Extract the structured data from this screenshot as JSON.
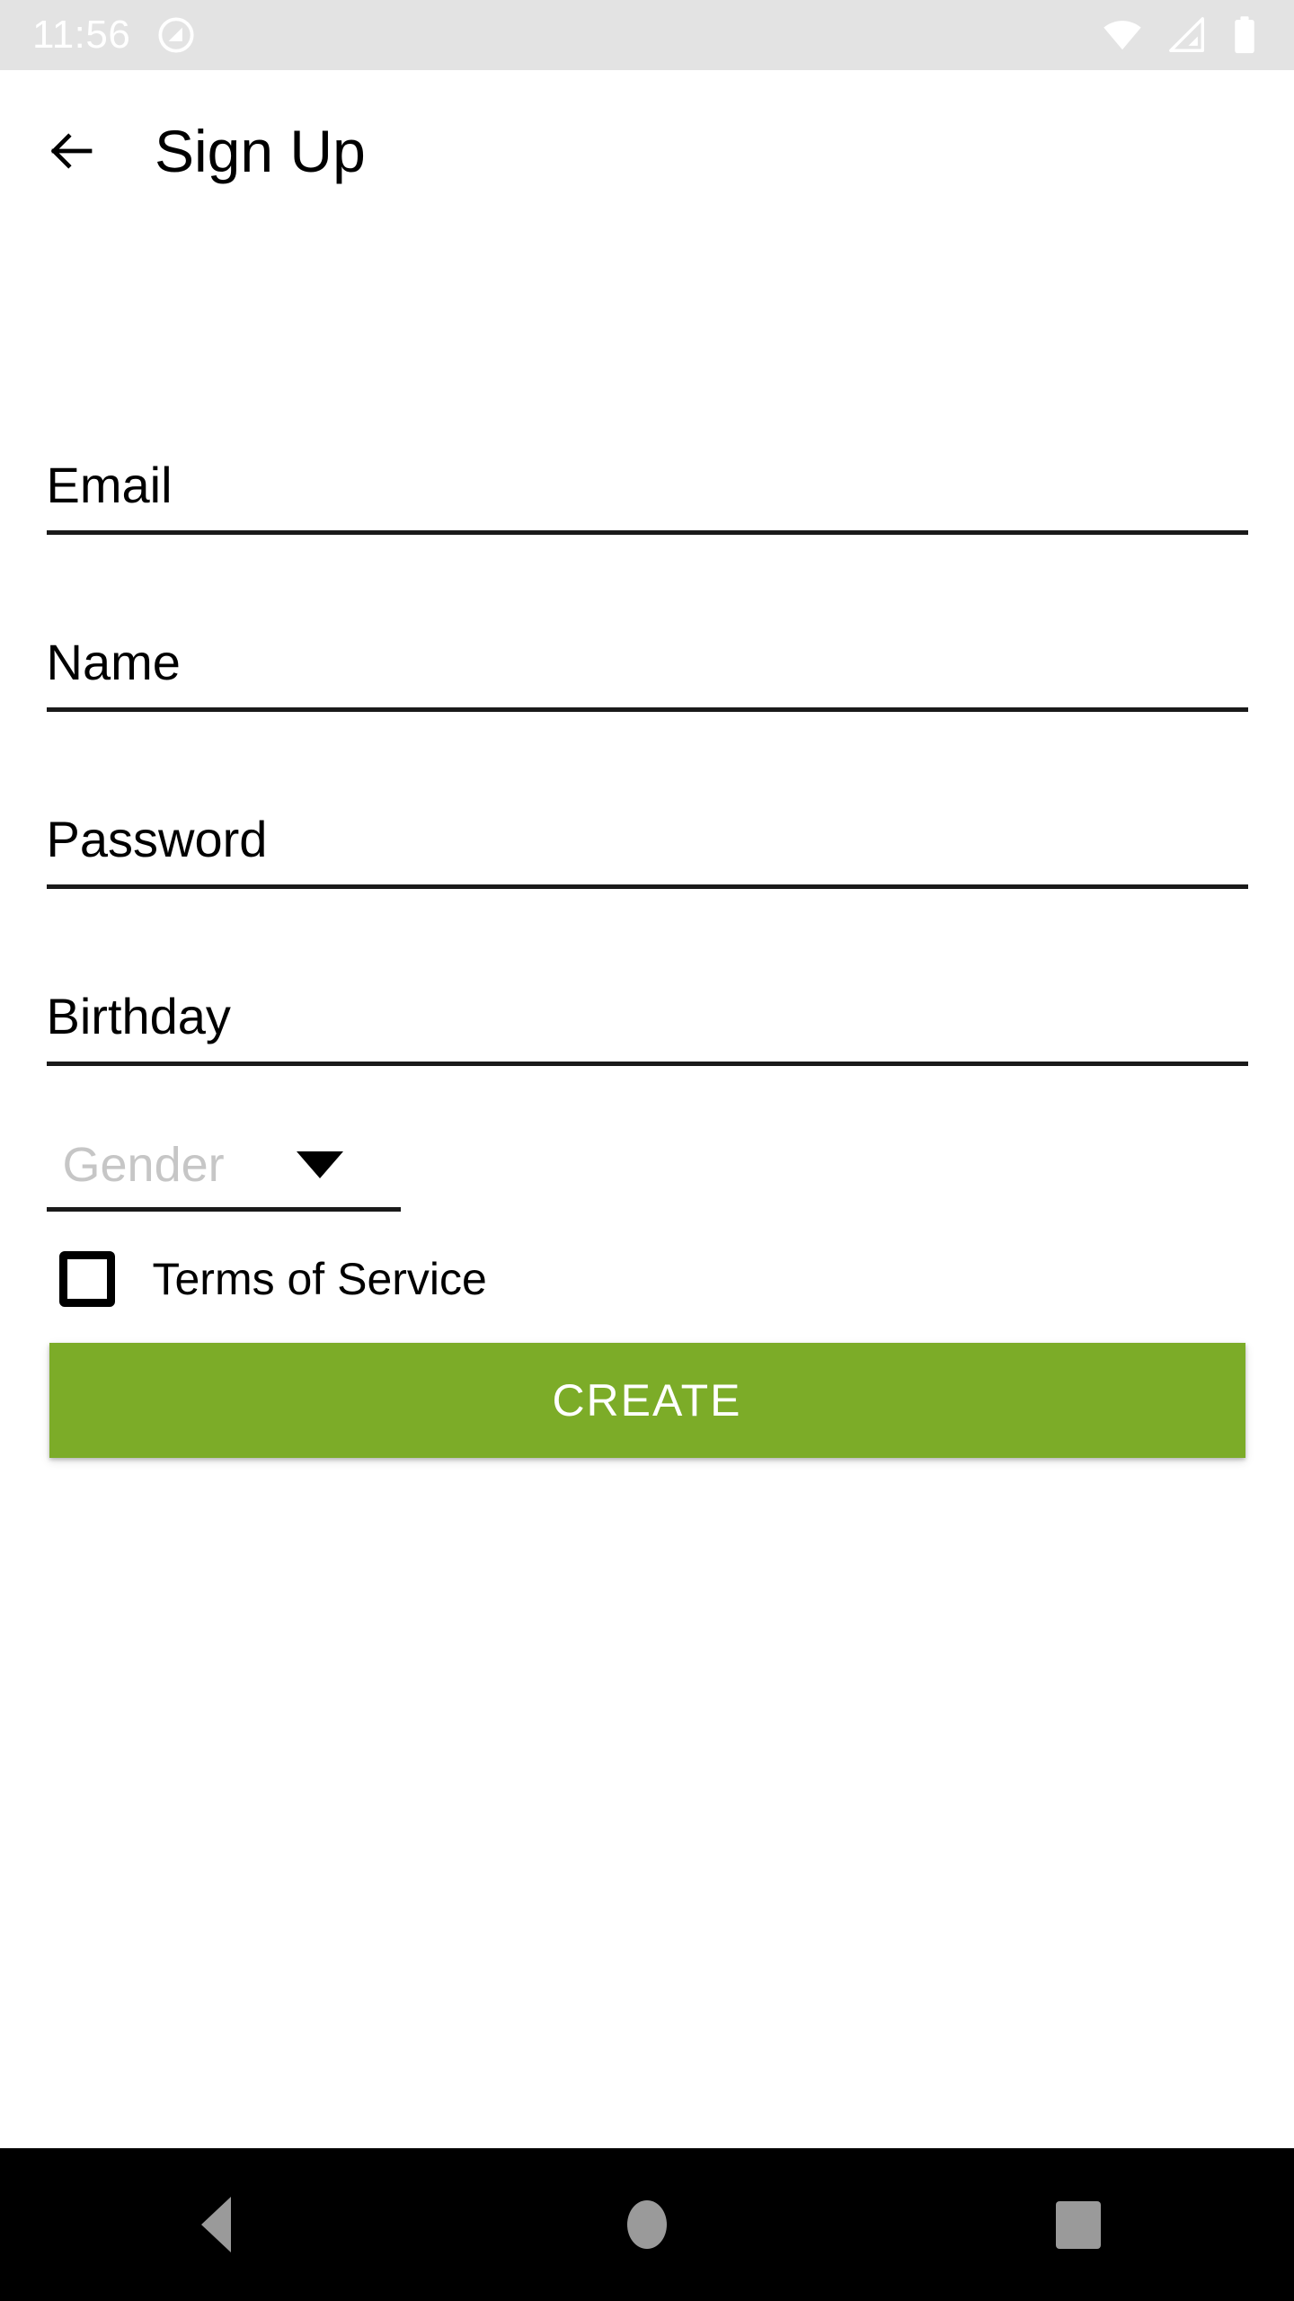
{
  "status_bar": {
    "time": "11:56",
    "icons": [
      "do-not-disturb-icon",
      "wifi-icon",
      "cell-signal-icon",
      "battery-icon"
    ],
    "background_color": "#e3e3e3",
    "foreground_color": "#ffffff"
  },
  "app_bar": {
    "back_icon": "arrow-left-icon",
    "title": "Sign Up"
  },
  "form": {
    "fields": [
      {
        "name": "email",
        "label": "Email",
        "value": "Email",
        "placeholder": "Email"
      },
      {
        "name": "username",
        "label": "Name",
        "value": "Name",
        "placeholder": "Name"
      },
      {
        "name": "password",
        "label": "Password",
        "value": "Password",
        "placeholder": "Password"
      },
      {
        "name": "birthday",
        "label": "Birthday",
        "value": "Birthday",
        "placeholder": "Birthday"
      }
    ],
    "gender_select": {
      "label": "Gender",
      "value": "",
      "placeholder": "Gender",
      "arrow_icon": "chevron-down-icon",
      "selected": false,
      "placeholder_color": "#c6c6c6"
    },
    "terms_checkbox": {
      "label": "Terms of Service",
      "checked": false
    },
    "submit_button": {
      "label": "CREATE",
      "background_color": "#7cac28",
      "text_color": "#ffffff"
    }
  },
  "nav_bar": {
    "background_color": "#000000",
    "icon_color": "#9a9a9a",
    "buttons": [
      {
        "name": "back",
        "icon": "triangle-left-icon"
      },
      {
        "name": "home",
        "icon": "circle-icon"
      },
      {
        "name": "recents",
        "icon": "square-icon"
      }
    ]
  }
}
